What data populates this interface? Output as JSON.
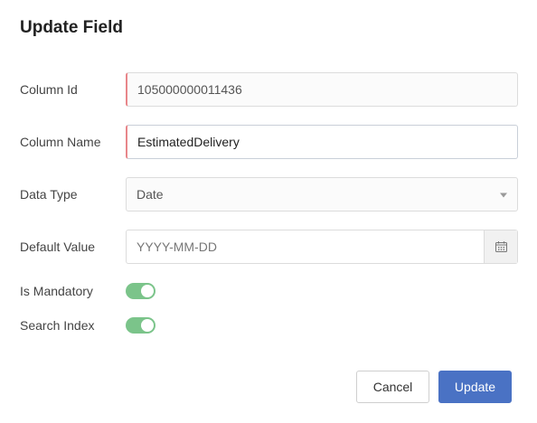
{
  "dialog": {
    "title": "Update Field"
  },
  "fields": {
    "column_id": {
      "label": "Column Id",
      "value": "105000000011436"
    },
    "column_name": {
      "label": "Column Name",
      "value": "EstimatedDelivery"
    },
    "data_type": {
      "label": "Data Type",
      "value": "Date"
    },
    "default_value": {
      "label": "Default Value",
      "placeholder": "YYYY-MM-DD",
      "value": ""
    },
    "is_mandatory": {
      "label": "Is Mandatory",
      "on": true
    },
    "search_index": {
      "label": "Search Index",
      "on": true
    }
  },
  "buttons": {
    "cancel_label": "Cancel",
    "update_label": "Update"
  },
  "icons": {
    "data_type_caret": "chevron-down-icon",
    "default_value_picker": "calendar-icon"
  },
  "colors": {
    "toggle_on": "#7bc48a",
    "primary": "#4a72c4",
    "required_marker": "#e8868a"
  }
}
